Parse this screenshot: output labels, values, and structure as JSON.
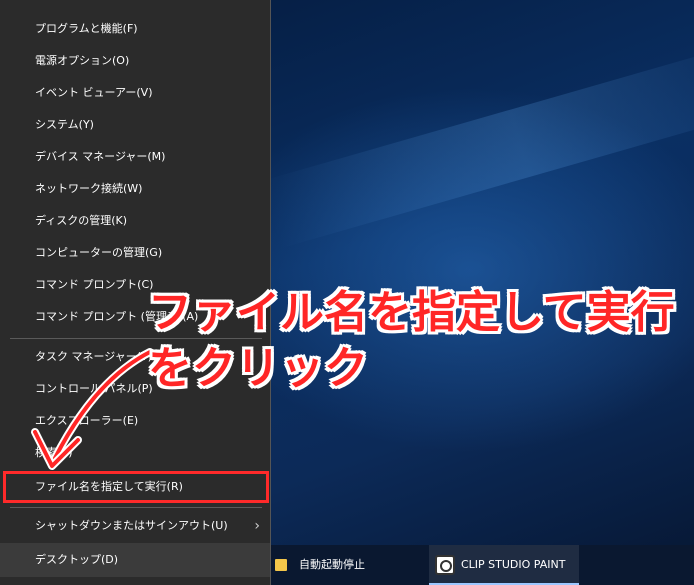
{
  "menu": {
    "items": [
      {
        "label": "プログラムと機能(F)"
      },
      {
        "label": "電源オプション(O)"
      },
      {
        "label": "イベント ビューアー(V)"
      },
      {
        "label": "システム(Y)"
      },
      {
        "label": "デバイス マネージャー(M)"
      },
      {
        "label": "ネットワーク接続(W)"
      },
      {
        "label": "ディスクの管理(K)"
      },
      {
        "label": "コンピューターの管理(G)"
      },
      {
        "label": "コマンド プロンプト(C)"
      },
      {
        "label": "コマンド プロンプト (管理者)(A)"
      },
      {
        "label": "タスク マネージャー(T)"
      },
      {
        "label": "コントロール パネル(P)"
      },
      {
        "label": "エクスプローラー(E)"
      },
      {
        "label": "検索(S)"
      },
      {
        "label": "ファイル名を指定して実行(R)"
      },
      {
        "label": "シャットダウンまたはサインアウト(U)"
      },
      {
        "label": "デスクトップ(D)"
      }
    ],
    "submenu_glyph": "›"
  },
  "taskbar": {
    "items": [
      {
        "label": "自動起動停止",
        "icon": "folder-icon"
      },
      {
        "label": "CLIP STUDIO PAINT",
        "icon": "clip-studio-paint-icon"
      }
    ]
  },
  "annotation": {
    "line1": "ファイル名を指定して実行",
    "line2": "をクリック",
    "color": "#ff2626"
  }
}
